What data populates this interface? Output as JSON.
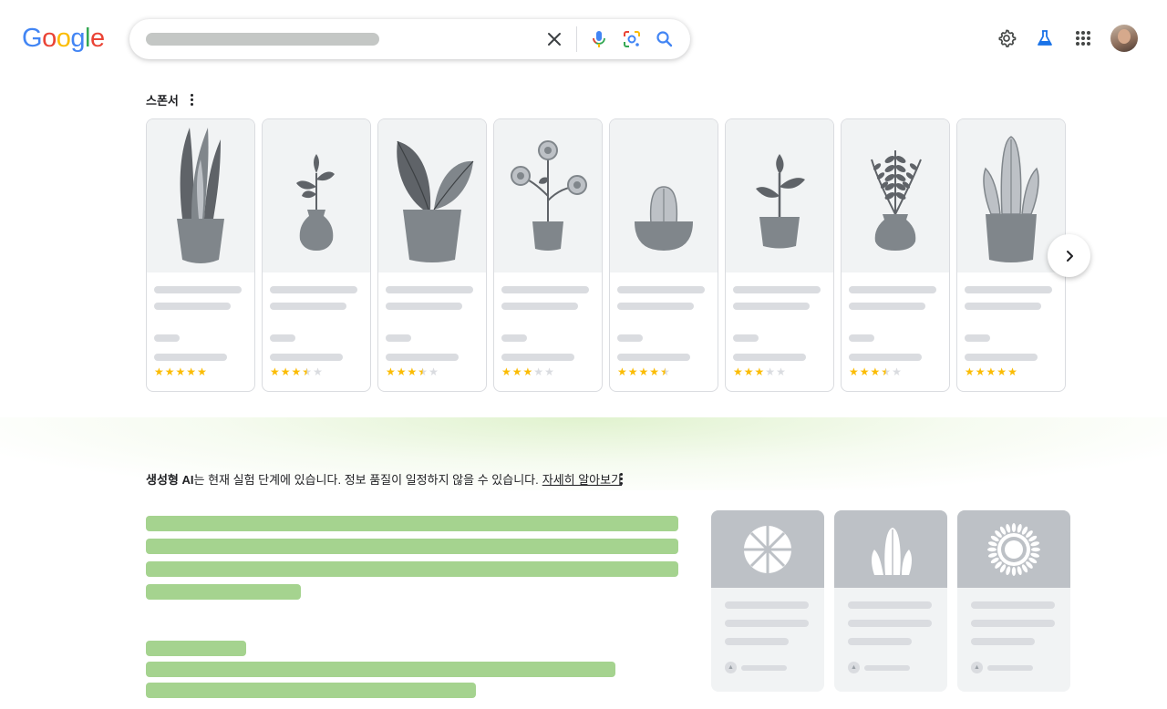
{
  "header": {
    "logo_letters": [
      {
        "char": "G",
        "color": "#4285f4"
      },
      {
        "char": "o",
        "color": "#ea4335"
      },
      {
        "char": "o",
        "color": "#fbbc04"
      },
      {
        "char": "g",
        "color": "#4285f4"
      },
      {
        "char": "l",
        "color": "#34a853"
      },
      {
        "char": "e",
        "color": "#ea4335"
      }
    ],
    "search": {
      "query_redacted": true,
      "icons": [
        "close-icon",
        "microphone-icon",
        "lens-icon",
        "search-icon"
      ]
    },
    "right_icons": [
      "settings-gear-icon",
      "labs-flask-icon",
      "apps-grid-icon",
      "profile-avatar"
    ]
  },
  "sponsored": {
    "title": "스폰서",
    "products": [
      {
        "plant": "snake-plant-icon",
        "rating": 5
      },
      {
        "plant": "sprout-vase-icon",
        "rating": 3.5
      },
      {
        "plant": "monstera-icon",
        "rating": 3.5
      },
      {
        "plant": "flower-pot-icon",
        "rating": 3
      },
      {
        "plant": "cactus-bowl-icon",
        "rating": 4.5
      },
      {
        "plant": "seedling-icon",
        "rating": 3
      },
      {
        "plant": "fern-vase-icon",
        "rating": 3.5
      },
      {
        "plant": "tall-cactus-icon",
        "rating": 5
      }
    ],
    "next_icon": "chevron-right-icon"
  },
  "ai_overview": {
    "notice_bold": "생성형 AI",
    "notice_text": "는 현재 실험 단계에 있습니다. 정보 품질이 일정하지 않을 수 있습니다.",
    "learn_more": "자세히 알아보기",
    "accent_color": "#a5d38f",
    "cards": [
      {
        "image": "leaf-icon"
      },
      {
        "image": "cactus-icon"
      },
      {
        "image": "sunflower-icon"
      }
    ]
  }
}
